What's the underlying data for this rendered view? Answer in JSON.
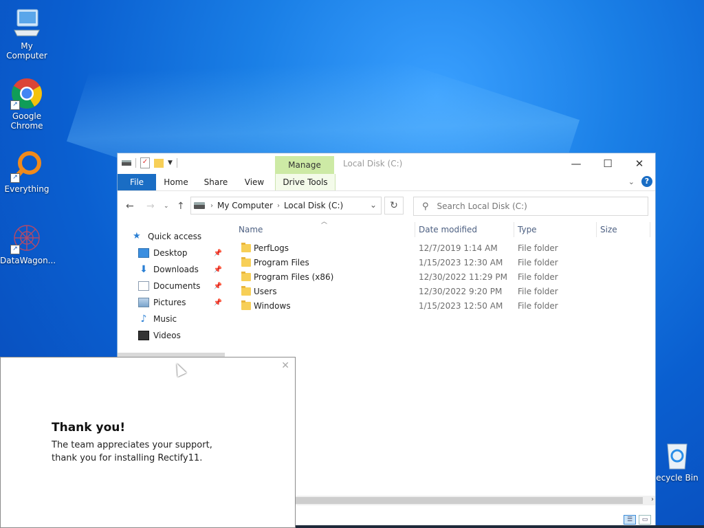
{
  "desktop": {
    "icons": [
      {
        "label": "My Computer",
        "icon": "computer-icon"
      },
      {
        "label": "Google Chrome",
        "icon": "chrome-icon"
      },
      {
        "label": "Everything",
        "icon": "everything-icon"
      },
      {
        "label": "DataWagon...",
        "icon": "datawagon-icon"
      },
      {
        "label": "ecycle Bin",
        "icon": "recycle-bin-icon"
      }
    ]
  },
  "explorer": {
    "title": "Local Disk (C:)",
    "contextual_tab": "Manage",
    "ribbon_tabs": [
      "File",
      "Home",
      "Share",
      "View",
      "Drive Tools"
    ],
    "address": {
      "crumbs": [
        "My Computer",
        "Local Disk (C:)"
      ]
    },
    "search": {
      "placeholder": "Search Local Disk (C:)"
    },
    "nav": {
      "quick_access": "Quick access",
      "items": [
        {
          "label": "Desktop",
          "pinned": true
        },
        {
          "label": "Downloads",
          "pinned": true
        },
        {
          "label": "Documents",
          "pinned": true
        },
        {
          "label": "Pictures",
          "pinned": true
        },
        {
          "label": "Music",
          "pinned": false
        },
        {
          "label": "Videos",
          "pinned": false
        }
      ]
    },
    "columns": [
      "Name",
      "Date modified",
      "Type",
      "Size"
    ],
    "files": [
      {
        "name": "PerfLogs",
        "date": "12/7/2019 1:14 AM",
        "type": "File folder"
      },
      {
        "name": "Program Files",
        "date": "1/15/2023 12:30 AM",
        "type": "File folder"
      },
      {
        "name": "Program Files (x86)",
        "date": "12/30/2022 11:29 PM",
        "type": "File folder"
      },
      {
        "name": "Users",
        "date": "12/30/2022 9:20 PM",
        "type": "File folder"
      },
      {
        "name": "Windows",
        "date": "1/15/2023 12:50 AM",
        "type": "File folder"
      }
    ]
  },
  "popup": {
    "title": "Thank you!",
    "message": "The team appreciates your support, thank you for installing Rectify11."
  },
  "colors": {
    "accent": "#1a6dc4",
    "manage_tab": "#cdeaa5",
    "folder": "#f7cf57"
  }
}
